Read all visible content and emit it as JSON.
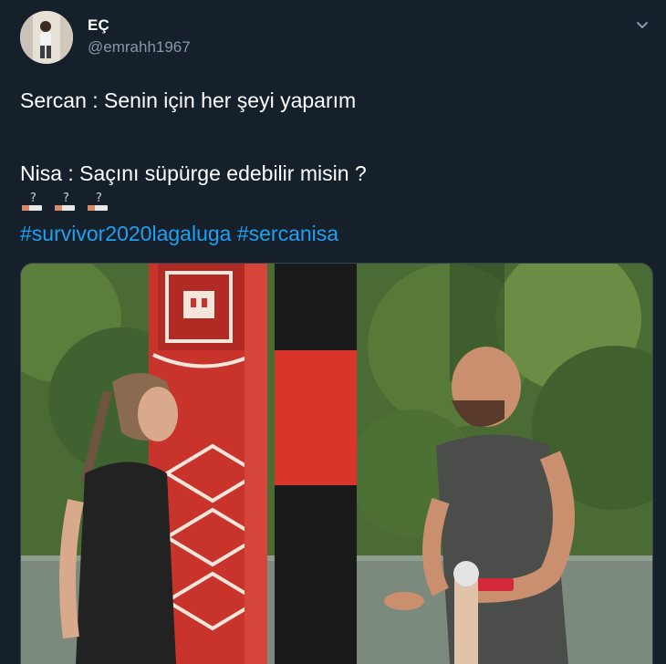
{
  "author": {
    "display_name": "EÇ ",
    "handle": "@emrahh1967",
    "avatar_icon": "user-avatar-photo"
  },
  "tweet": {
    "line1": "Sercan : Senin için her şeyi yaparım",
    "line2": "Nisa : Saçını süpürge edebilir misin ?",
    "emoji_name": "broom-question-emoji",
    "emoji_count": 3,
    "hashtags": [
      "#survivor2020lagaluga",
      "#sercanisa"
    ]
  },
  "media": {
    "type": "photo",
    "description_icon": "tv-still-image"
  },
  "colors": {
    "background": "#15202b",
    "text": "#ffffff",
    "secondary": "#8899a6",
    "link": "#1da1f2"
  }
}
